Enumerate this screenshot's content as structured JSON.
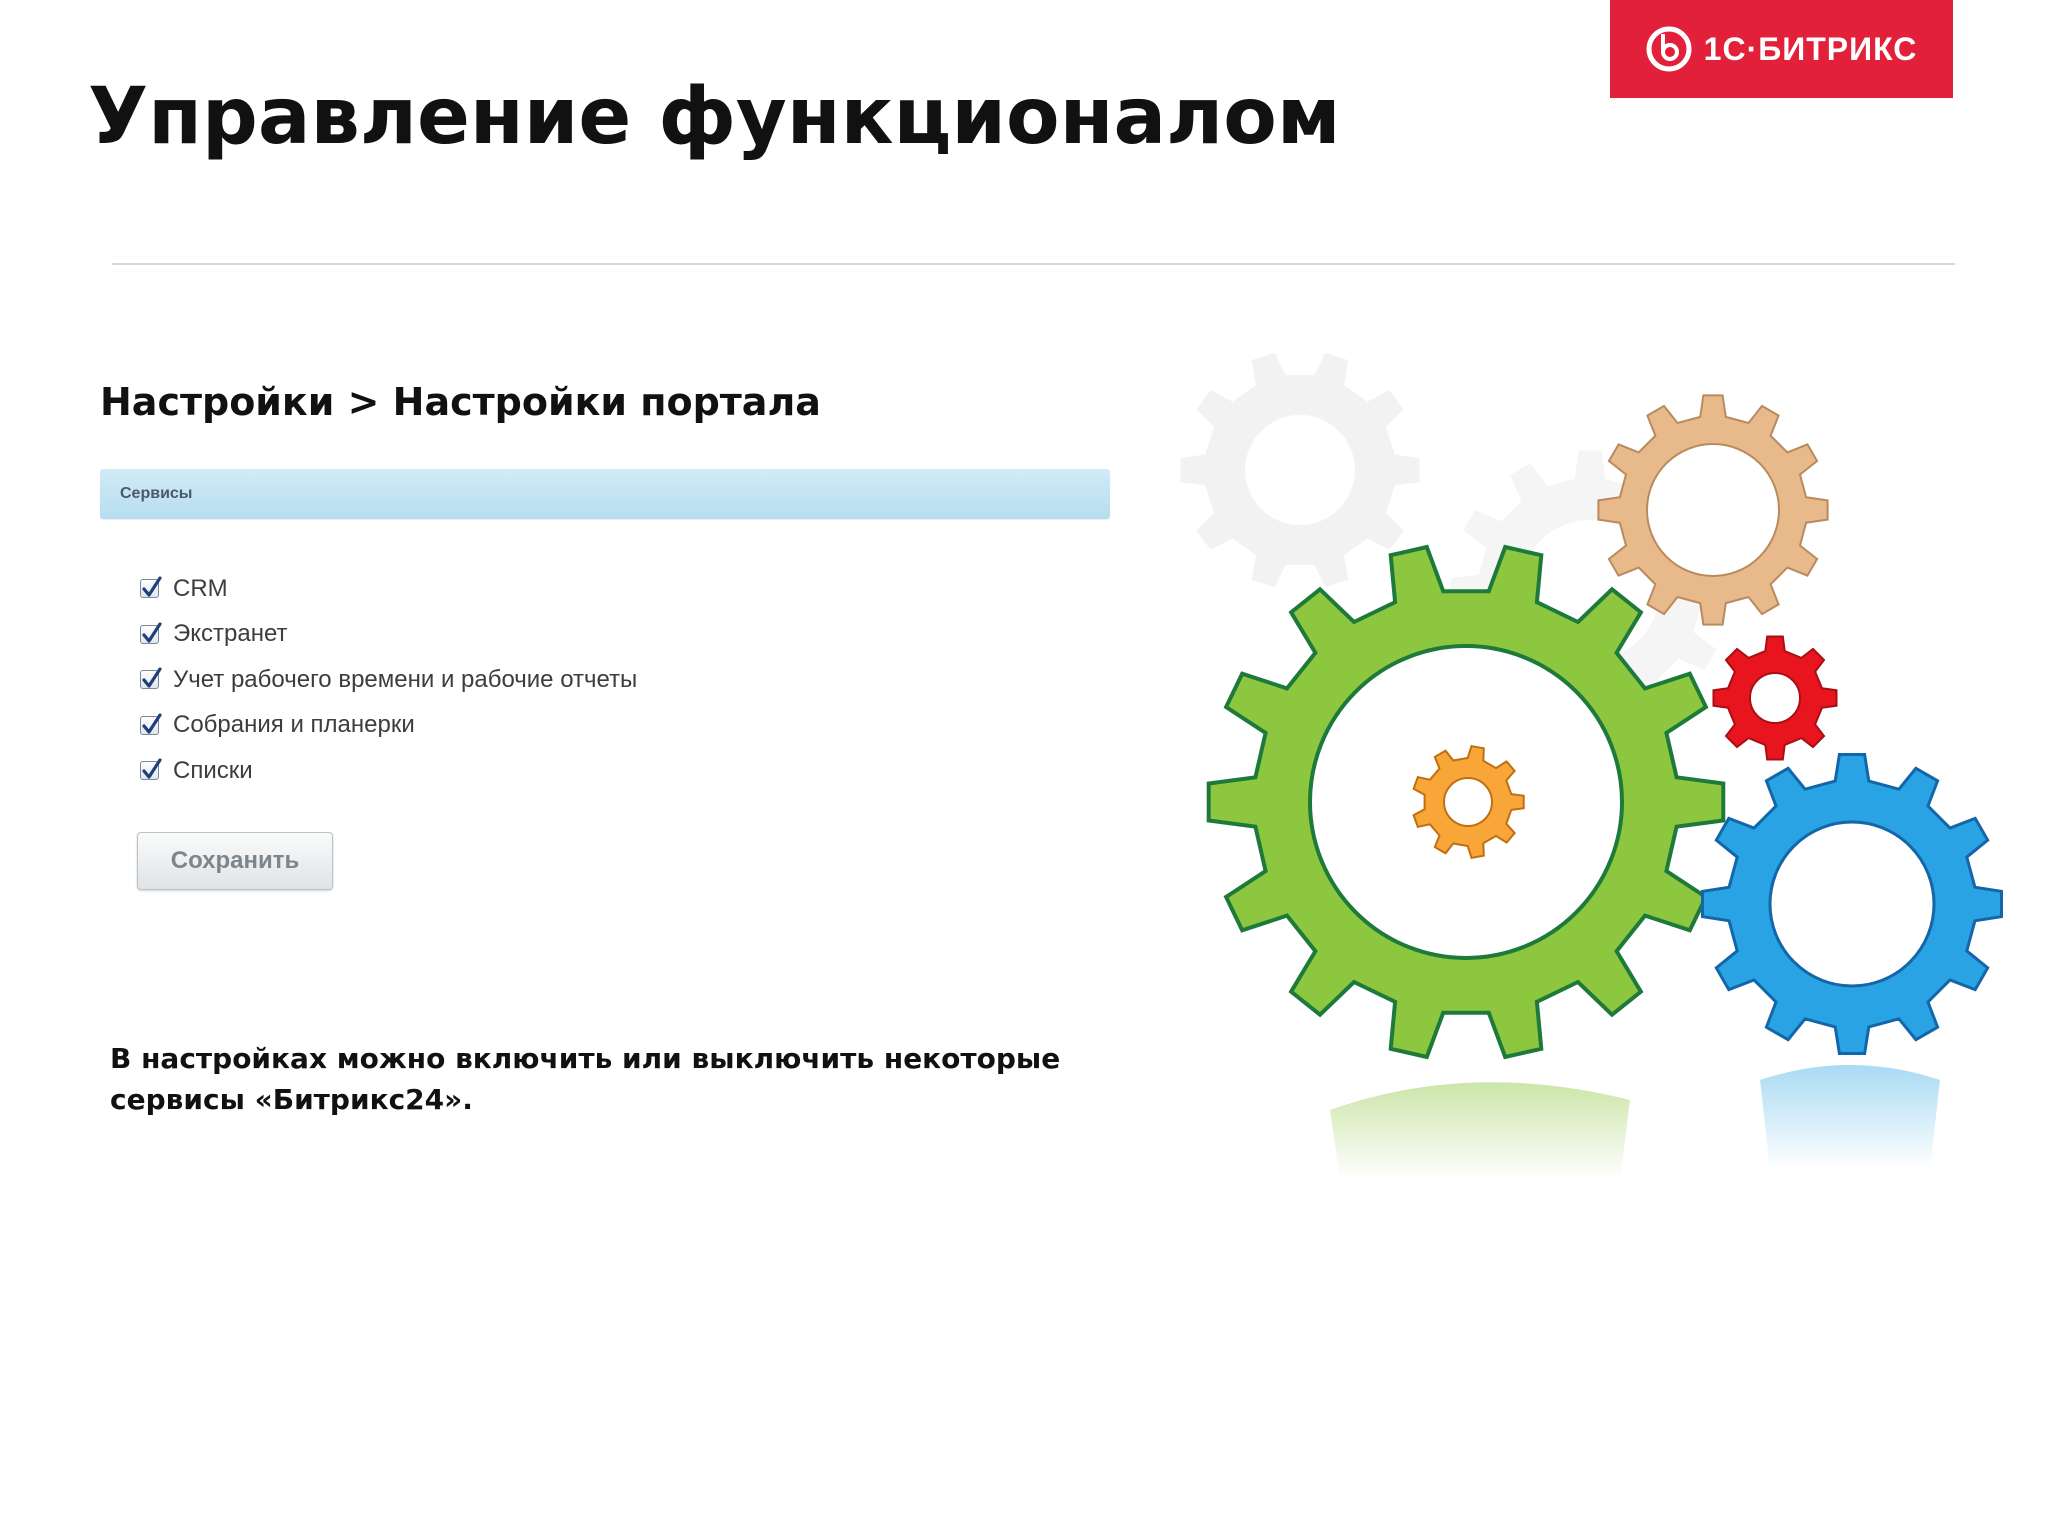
{
  "logo": {
    "text": "1С·БИТРИКС",
    "background": "#e2203a",
    "foreground": "#ffffff"
  },
  "slide": {
    "title": "Управление функционалом",
    "breadcrumb": "Настройки > Настройки портала",
    "description_line1": "В настройках можно включить или выключить некоторые",
    "description_line2": "сервисы «Битрикс24»."
  },
  "panel": {
    "header_label": "Сервисы",
    "header_color": "#c4e4f3"
  },
  "services": [
    {
      "label": "CRM",
      "checked": true
    },
    {
      "label": "Экстранет",
      "checked": true
    },
    {
      "label": "Учет рабочего времени и рабочие отчеты",
      "checked": true
    },
    {
      "label": "Собрания и планерки",
      "checked": true
    },
    {
      "label": "Списки",
      "checked": true
    }
  ],
  "save_button": {
    "label": "Сохранить"
  },
  "illustration": {
    "icon": "gears-icon",
    "colors": {
      "green": "#8dc63f",
      "blue": "#29a3e3",
      "red": "#e8141e",
      "tan": "#e8b98a",
      "orange": "#f8a638"
    }
  }
}
